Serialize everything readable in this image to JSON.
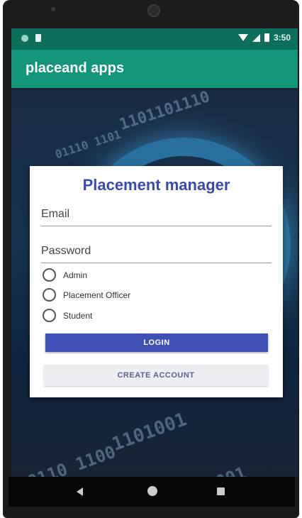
{
  "status_bar": {
    "time": "3:50",
    "icons": [
      "notification-icon",
      "sd-card-icon",
      "wifi-icon",
      "signal-icon",
      "battery-icon"
    ]
  },
  "app_bar": {
    "title": "placeand apps",
    "color": "#13957c"
  },
  "login_card": {
    "title": "Placement manager",
    "email": {
      "placeholder": "Email",
      "value": ""
    },
    "password": {
      "placeholder": "Password",
      "value": ""
    },
    "roles": [
      {
        "label": "Admin",
        "selected": false
      },
      {
        "label": "Placement Officer",
        "selected": false
      },
      {
        "label": "Student",
        "selected": false
      }
    ],
    "login_label": "LOGIN",
    "create_account_label": "CREATE ACCOUNT"
  },
  "navigation": {
    "icons": [
      "back-icon",
      "home-icon",
      "recents-icon"
    ]
  },
  "colors": {
    "accent": "#3f51b5",
    "title": "#3b4ab0",
    "status_bar": "#0d6e5c"
  }
}
